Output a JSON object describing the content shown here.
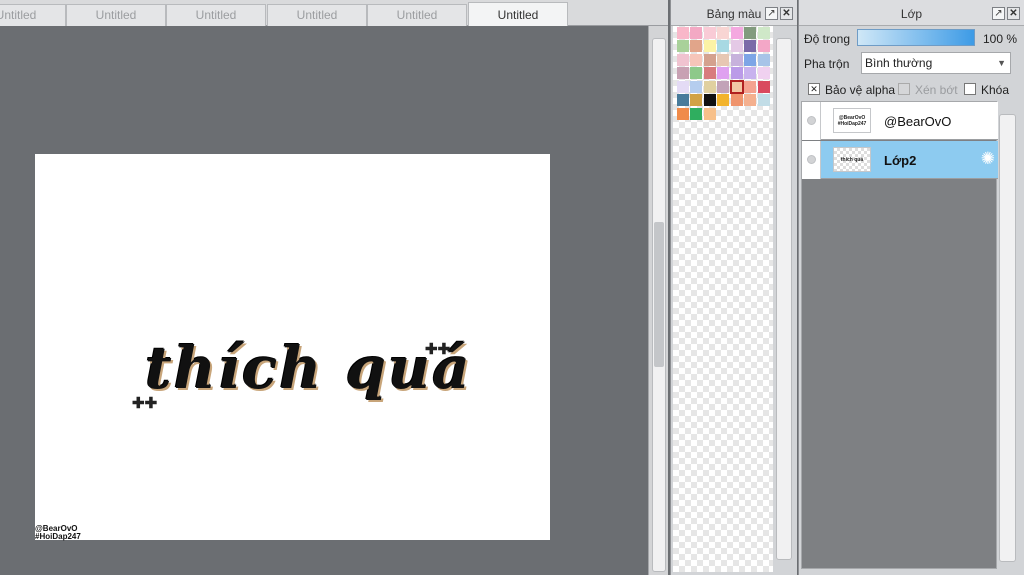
{
  "tabs": [
    {
      "label": "Untitled"
    },
    {
      "label": "Untitled"
    },
    {
      "label": "Untitled"
    },
    {
      "label": "Untitled"
    },
    {
      "label": "Untitled"
    },
    {
      "label": "Untitled",
      "active": true
    }
  ],
  "canvas": {
    "artwork_word1": "thích",
    "artwork_word2": "quá",
    "watermark_line1": "@BearOvO",
    "watermark_line2": "#HoiDap247"
  },
  "palette": {
    "title": "Bảng màu",
    "swatches": [
      "#f9b7c9",
      "#f3a9c4",
      "#f9cbd6",
      "#f8d5d3",
      "#f4a9e0",
      "#829b7e",
      "#cfe8c8",
      "#a9d19a",
      "#e1a58a",
      "#fbf3a6",
      "#a8d9e3",
      "#e4c9e6",
      "#7b6aa8",
      "#f3a7c7",
      "#f0c3d0",
      "#f6c5b9",
      "#d4a18e",
      "#e7c7b3",
      "#c7b2dc",
      "#7da5e6",
      "#a8c4e8",
      "#c8a1b3",
      "#8ec98a",
      "#d87b7e",
      "#dfa1f0",
      "#bb9be8",
      "#c8b2ee",
      "#f0d1f0",
      "#e4dbf5",
      "#b5cdee",
      "#e0d0a0",
      "#c2a3b8",
      "#f2c7a4",
      "#f4a28f",
      "#d94a5f",
      "#487b9b",
      "#d1a245",
      "#111111",
      "#f2b32c",
      "#ef946d",
      "#f4b08f",
      "#c2dde7",
      "#f08b4a",
      "#2fae5f",
      "#f7c08a"
    ],
    "selected_index": 32
  },
  "layers_panel": {
    "title": "Lớp",
    "opacity_label": "Độ trong",
    "opacity_value": "100 %",
    "opacity": 1.0,
    "blend_label": "Pha trộn",
    "blend_value": "Bình thường",
    "protect_alpha_label": "Bảo vệ alpha",
    "protect_alpha_checked": true,
    "clipping_label": "Xén bớt",
    "lock_label": "Khóa",
    "layers": [
      {
        "name": "@BearOvO",
        "thumb_line1": "@BearOvO",
        "thumb_line2": "#HoiDap247",
        "selected": false
      },
      {
        "name": "Lớp2",
        "thumb_text": "thích quá",
        "selected": true
      }
    ]
  }
}
